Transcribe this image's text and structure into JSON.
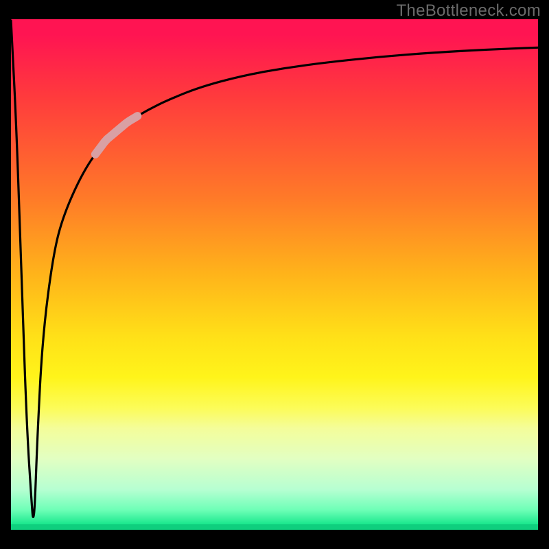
{
  "watermark": "TheBottleneck.com",
  "chart_data": {
    "type": "line",
    "title": "",
    "xlabel": "",
    "ylabel": "",
    "xlim": [
      0,
      100
    ],
    "ylim": [
      0,
      100
    ],
    "grid": false,
    "legend": false,
    "series": [
      {
        "name": "bottleneck-curve",
        "x": [
          0,
          1,
          2,
          3,
          4,
          4.2,
          4.5,
          5,
          6,
          8,
          10,
          14,
          18,
          22,
          26,
          30,
          36,
          44,
          52,
          60,
          70,
          80,
          90,
          100
        ],
        "y": [
          100,
          80,
          50,
          20,
          4,
          2,
          4,
          18,
          38,
          54,
          62,
          71,
          76.5,
          80,
          82.5,
          84.5,
          87,
          89.2,
          90.7,
          91.8,
          92.9,
          93.7,
          94.3,
          94.7
        ]
      }
    ],
    "highlight_segment": {
      "x_start": 16,
      "x_end": 24,
      "description": "pale-pink marker segment on the rising edge"
    },
    "background": {
      "type": "vertical-gradient",
      "stops": [
        {
          "pct": 0,
          "color": "#ff1452"
        },
        {
          "pct": 35,
          "color": "#ff7a28"
        },
        {
          "pct": 62,
          "color": "#ffe018"
        },
        {
          "pct": 80,
          "color": "#f4fd9a"
        },
        {
          "pct": 96,
          "color": "#6dffb7"
        },
        {
          "pct": 100,
          "color": "#0fd07e"
        }
      ]
    }
  }
}
